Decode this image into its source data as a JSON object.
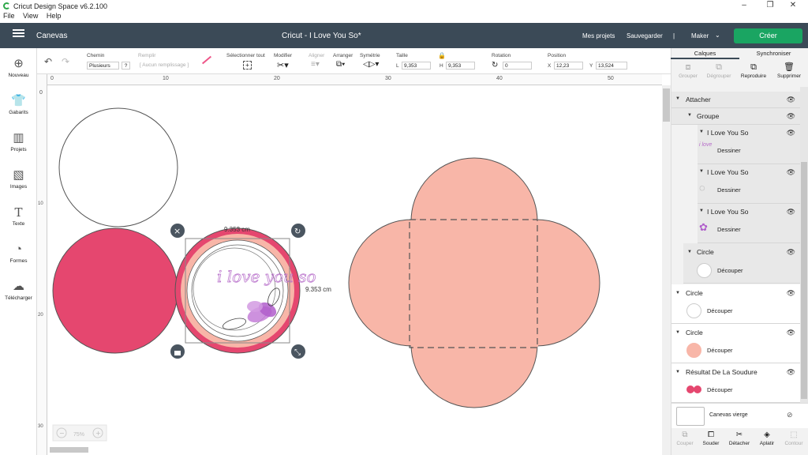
{
  "window": {
    "title": "Cricut Design Space  v6.2.100",
    "minimize": "–",
    "maximize": "❐",
    "close": "✕"
  },
  "menu": [
    "File",
    "View",
    "Help"
  ],
  "header": {
    "section": "Canevas",
    "project_title": "Cricut - I Love You So*",
    "my_projects": "Mes projets",
    "save": "Sauvegarder",
    "separator": "|",
    "machine": "Maker",
    "create": "Créer"
  },
  "toolbar": {
    "undo_icon": "undo-icon",
    "chemin_label": "Chemin",
    "chemin_value": "Plusieurs",
    "help": "?",
    "remplir_label": "Remplir",
    "remplir_value": "[ Aucun remplissage ]",
    "select_all_label": "Sélectionner tout",
    "modify_label": "Modifier",
    "align_label": "Aligner",
    "arrange_label": "Arranger",
    "symmetry_label": "Symétrie",
    "size_label": "Taille",
    "l_label": "L",
    "l_value": "9,353",
    "h_label": "H",
    "h_value": "9,353",
    "rotation_label": "Rotation",
    "rotation_value": "0",
    "position_label": "Position",
    "x_label": "X",
    "x_value": "12,23",
    "y_label": "Y",
    "y_value": "13,524"
  },
  "leftbar": [
    {
      "label": "Nouveau",
      "icon": "plus-circle-icon"
    },
    {
      "label": "Gabarits",
      "icon": "shirt-icon"
    },
    {
      "label": "Projets",
      "icon": "book-icon"
    },
    {
      "label": "Images",
      "icon": "image-icon"
    },
    {
      "label": "Texte",
      "icon": "text-icon"
    },
    {
      "label": "Formes",
      "icon": "shapes-icon"
    },
    {
      "label": "Télécharger",
      "icon": "upload-cloud-icon"
    }
  ],
  "ruler": {
    "top": [
      "0",
      "10",
      "20",
      "30",
      "40",
      "50"
    ],
    "left": [
      "0",
      "10",
      "20",
      "30"
    ]
  },
  "canvas": {
    "width_dim": "9.353 cm",
    "height_dim": "9.353 cm",
    "design_text": "i love you so",
    "zoom": "75%",
    "colors": {
      "pink": "#e5476f",
      "salmon": "#f8b6a8",
      "outline": "#555555",
      "selection": "#888888"
    }
  },
  "rightpanel": {
    "tabs": [
      "Calques",
      "Synchroniser"
    ],
    "tools": [
      "Grouper",
      "Dégrouper",
      "Reproduire",
      "Supprimer"
    ],
    "layers": [
      {
        "label": "Attacher"
      },
      {
        "label": "Groupe"
      },
      {
        "label": "I Love You So",
        "sub": "Dessiner"
      },
      {
        "label": "I Love You So",
        "sub": "Dessiner"
      },
      {
        "label": "I Love You So",
        "sub": "Dessiner"
      },
      {
        "label": "Circle",
        "sub": "Découper"
      },
      {
        "label": "Circle",
        "sub": "Découper"
      },
      {
        "label": "Circle",
        "sub": "Découper"
      },
      {
        "label": "Résultat De La Soudure",
        "sub": "Découper"
      }
    ],
    "blank_canvas": "Canevas vierge",
    "bottom_tools": [
      "Couper",
      "Souder",
      "Détacher",
      "Aplatir",
      "Contour"
    ]
  }
}
